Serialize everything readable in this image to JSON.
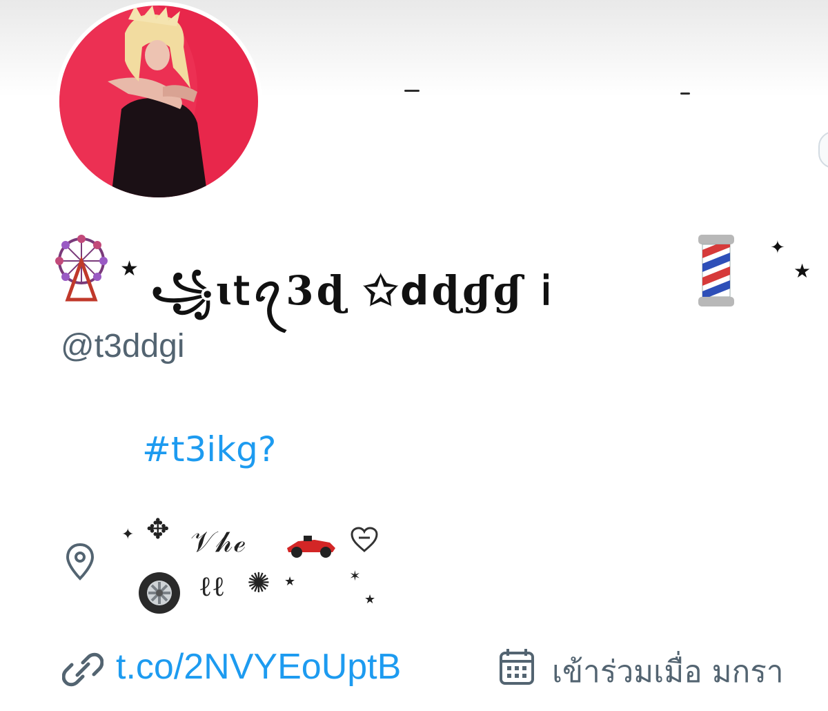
{
  "profile": {
    "display_name": "꧁ɩ𝗍ꪖ𝟑ɖ ✩𝗱ɖɠɠ 𝗂",
    "handle": "@t3ddgi",
    "bio_hashtag": "#t3ikg?",
    "location_text": "𝒱𝒽ℯ",
    "website": "t.co/2NVYEoUptB",
    "joined": "เข้าร่วมเมื่อ มกรา"
  },
  "icons": {
    "avatar": "avatar",
    "ferris_wheel": "ferris-wheel-icon",
    "barber_pole": "barber-pole-icon",
    "location": "location-pin-icon",
    "link": "link-icon",
    "calendar": "calendar-icon",
    "race_car": "race-car-icon",
    "tire": "tire-icon",
    "heart": "heart-icon",
    "sparkle": "sparkle-icon"
  },
  "colors": {
    "link": "#1d9bf0",
    "secondary_text": "#536471",
    "avatar_bg": "#e8274b"
  }
}
